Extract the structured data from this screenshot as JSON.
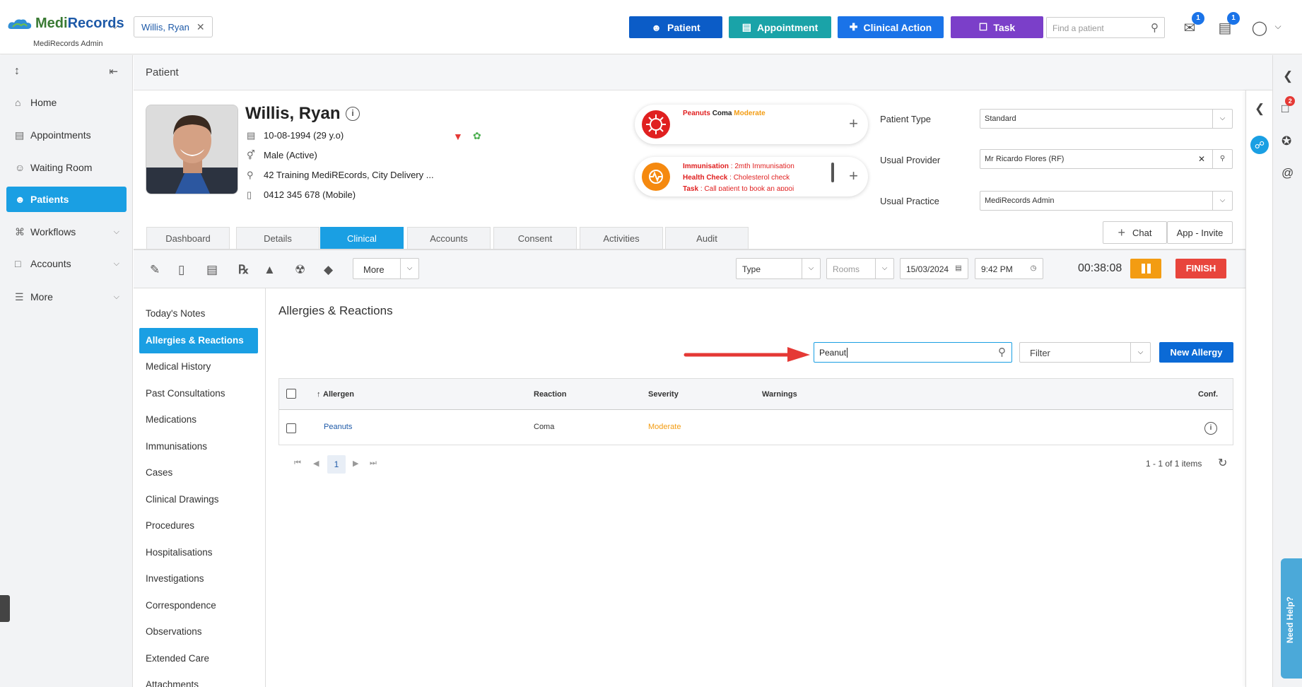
{
  "app": {
    "logo_main": "Medi",
    "logo_accent": "Records",
    "logo_sub": "MediRecords Admin"
  },
  "header": {
    "patient_chip": "Willis, Ryan",
    "buttons": [
      {
        "label": "Patient",
        "color": "#0b5cc7"
      },
      {
        "label": "Appointment",
        "color": "#1aa3a8"
      },
      {
        "label": "Clinical Action",
        "color": "#1a73e8"
      },
      {
        "label": "Task",
        "color": "#7b3fc9"
      }
    ],
    "find_placeholder": "Find a patient",
    "mail_badge": "1",
    "tasks_badge": "1"
  },
  "nav": {
    "items": [
      {
        "label": "Home",
        "icon": "home-icon"
      },
      {
        "label": "Appointments",
        "icon": "calendar-icon"
      },
      {
        "label": "Waiting Room",
        "icon": "people-icon"
      },
      {
        "label": "Patients",
        "icon": "patients-icon",
        "active": true
      },
      {
        "label": "Workflows",
        "icon": "workflow-icon"
      },
      {
        "label": "Accounts",
        "icon": "folder-icon"
      },
      {
        "label": "More",
        "icon": "more-icon"
      }
    ]
  },
  "page": {
    "title": "Patient"
  },
  "patient": {
    "name": "Willis, Ryan",
    "dob": "10-08-1994 (29 y.o)",
    "gender": "Male (Active)",
    "address": "42 Training MediREcords, City Delivery ...",
    "phone": "0412 345 678 (Mobile)"
  },
  "alerts": {
    "allergy": {
      "allergen": "Peanuts",
      "reaction": "Coma",
      "severity": "Moderate"
    },
    "reminders": [
      {
        "label": "Immunisation",
        "value": "2mth Immunisation"
      },
      {
        "label": "Health Check",
        "value": "Cholesterol check"
      },
      {
        "label": "Task",
        "value": "Call patient to book an appoi"
      }
    ]
  },
  "fields": {
    "patient_type": {
      "label": "Patient Type",
      "value": "Standard"
    },
    "usual_provider": {
      "label": "Usual Provider",
      "value": "Mr Ricardo Flores (RF)"
    },
    "usual_practice": {
      "label": "Usual Practice",
      "value": "MediRecords Admin"
    }
  },
  "buttons": {
    "chat": "Chat",
    "app_invite": "App - Invite"
  },
  "tabs": [
    "Dashboard",
    "Details",
    "Clinical",
    "Accounts",
    "Consent",
    "Activities",
    "Audit"
  ],
  "active_tab": "Clinical",
  "toolbar": {
    "more": "More",
    "type_placeholder": "Type",
    "rooms_placeholder": "Rooms",
    "date": "15/03/2024",
    "time": "9:42 PM",
    "timer": "00:38:08",
    "finish": "FINISH"
  },
  "clinical_nav": [
    "Today's Notes",
    "Allergies & Reactions",
    "Medical History",
    "Past Consultations",
    "Medications",
    "Immunisations",
    "Cases",
    "Clinical Drawings",
    "Procedures",
    "Hospitalisations",
    "Investigations",
    "Correspondence",
    "Observations",
    "Extended Care",
    "Attachments"
  ],
  "allergies": {
    "title": "Allergies & Reactions",
    "search_value": "Peanut",
    "filter_placeholder": "Filter",
    "new_button": "New Allergy",
    "columns": [
      "Allergen",
      "Reaction",
      "Severity",
      "Warnings",
      "Conf."
    ],
    "rows": [
      {
        "allergen": "Peanuts",
        "reaction": "Coma",
        "severity": "Moderate",
        "warnings": ""
      }
    ],
    "page": "1",
    "items_text": "1 - 1 of 1 items"
  },
  "right_rail": {
    "chat_badge": "2",
    "help": "Need Help?"
  }
}
